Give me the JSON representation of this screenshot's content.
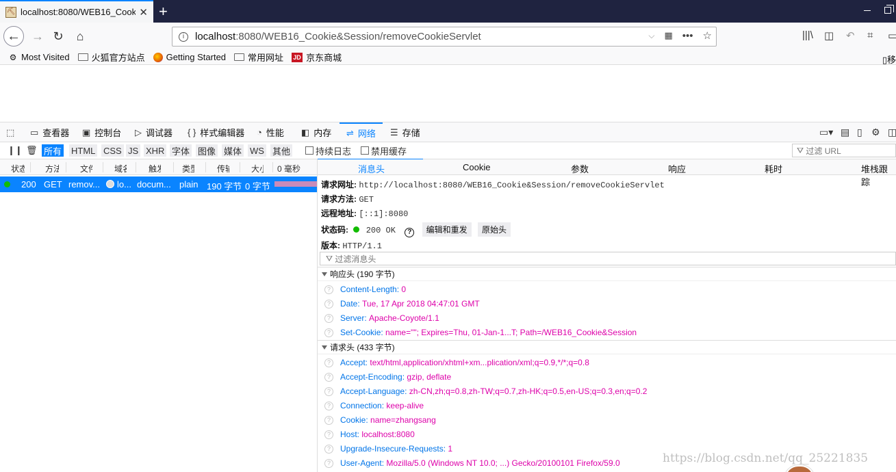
{
  "browser": {
    "tab_title": "localhost:8080/WEB16_Cook",
    "url_host": "localhost",
    "url_rest": ":8080/WEB16_Cookie&Session/removeCookieServlet"
  },
  "bookmarks": [
    {
      "label": "Most Visited",
      "icon": "gear-icon"
    },
    {
      "label": "火狐官方站点",
      "icon": "folder-icon"
    },
    {
      "label": "Getting Started",
      "icon": "firefox-icon"
    },
    {
      "label": "常用网址",
      "icon": "folder-icon"
    },
    {
      "label": "京东商城",
      "icon": "jd-icon"
    }
  ],
  "bookmarks_mobile": "移",
  "devtools": {
    "tools": [
      "查看器",
      "控制台",
      "调试器",
      "样式编辑器",
      "性能",
      "内存",
      "网络",
      "存储"
    ],
    "active_tool": "网络",
    "filters": [
      "所有",
      "HTML",
      "CSS",
      "JS",
      "XHR",
      "字体",
      "图像",
      "媒体",
      "WS",
      "其他"
    ],
    "persist_log": "持续日志",
    "disable_cache": "禁用缓存",
    "filter_url_placeholder": "过滤 URL"
  },
  "request_list": {
    "columns": [
      "状态",
      "方法",
      "文件",
      "域名",
      "触发",
      "类型",
      "传输",
      "大小",
      "0 毫秒"
    ],
    "rows": [
      {
        "status": "200",
        "method": "GET",
        "file": "remov...",
        "domain": "lo...",
        "cause": "docum...",
        "type": "plain",
        "transferred": "190 字节",
        "size": "0 字节"
      }
    ]
  },
  "detail": {
    "tabs": [
      "消息头",
      "Cookie",
      "参数",
      "响应",
      "耗时",
      "堆栈跟踪"
    ],
    "active_tab": "消息头",
    "request_url_label": "请求网址:",
    "request_url": "http://localhost:8080/WEB16_Cookie&Session/removeCookieServlet",
    "request_method_label": "请求方法:",
    "request_method": "GET",
    "remote_address_label": "远程地址:",
    "remote_address": "[::1]:8080",
    "status_code_label": "状态码:",
    "status_code": "200 OK",
    "edit_resend": "编辑和重发",
    "raw_headers": "原始头",
    "version_label": "版本:",
    "version": "HTTP/1.1",
    "filter_headers_placeholder": "过滤消息头",
    "response_headers_title": "响应头 (190 字节)",
    "response_headers": [
      {
        "name": "Content-Length:",
        "value": "0"
      },
      {
        "name": "Date:",
        "value": "Tue, 17 Apr 2018 04:47:01 GMT"
      },
      {
        "name": "Server:",
        "value": "Apache-Coyote/1.1"
      },
      {
        "name": "Set-Cookie:",
        "value": "name=\"\"; Expires=Thu, 01-Jan-1...T; Path=/WEB16_Cookie&Session"
      }
    ],
    "request_headers_title": "请求头 (433 字节)",
    "request_headers": [
      {
        "name": "Accept:",
        "value": "text/html,application/xhtml+xm...plication/xml;q=0.9,*/*;q=0.8"
      },
      {
        "name": "Accept-Encoding:",
        "value": "gzip, deflate"
      },
      {
        "name": "Accept-Language:",
        "value": "zh-CN,zh;q=0.8,zh-TW;q=0.7,zh-HK;q=0.5,en-US;q=0.3,en;q=0.2"
      },
      {
        "name": "Connection:",
        "value": "keep-alive"
      },
      {
        "name": "Cookie:",
        "value": "name=zhangsang"
      },
      {
        "name": "Host:",
        "value": "localhost:8080"
      },
      {
        "name": "Upgrade-Insecure-Requests:",
        "value": "1"
      },
      {
        "name": "User-Agent:",
        "value": "Mozilla/5.0 (Windows NT 10.0; ...) Gecko/20100101 Firefox/59.0"
      }
    ]
  },
  "watermark": "https://blog.csdn.net/qq_25221835",
  "colors": {
    "accent": "#0a84ff",
    "header_name": "#0074e8",
    "header_value": "#dd00a9",
    "status_ok": "#12bc00"
  }
}
